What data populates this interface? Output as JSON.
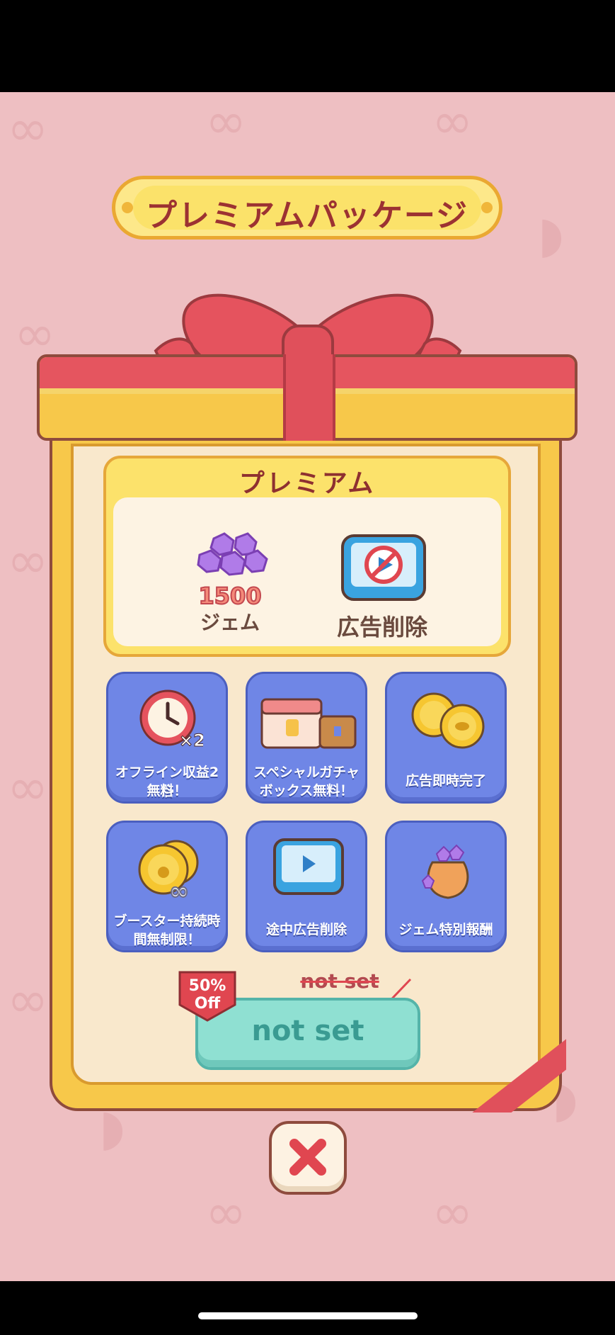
{
  "banner": {
    "title": "プレミアムパッケージ"
  },
  "premium": {
    "title": "プレミアム",
    "gems_count": "1500",
    "gems_label": "ジェム",
    "ad_remove_label": "広告削除"
  },
  "perks": [
    {
      "icon": "clock-x2-icon",
      "line1": "オフライン収益2倍",
      "line2": "無料！"
    },
    {
      "icon": "gacha-box-icon",
      "line1": "スペシャルガチャ",
      "line2": "ボックス無料！"
    },
    {
      "icon": "coins-icon",
      "line1": "広告即時完了",
      "line2": ""
    },
    {
      "icon": "infinite-coins-icon",
      "line1": "ブースター持続時",
      "line2": "間無制限！"
    },
    {
      "icon": "play-monitor-icon",
      "line1": "途中広告削除",
      "line2": ""
    },
    {
      "icon": "gem-bag-icon",
      "line1": "ジェム特別報酬",
      "line2": ""
    }
  ],
  "purchase": {
    "discount_line1": "50%",
    "discount_line2": "Off",
    "old_price": "not set",
    "price": "not set"
  },
  "colors": {
    "background": "#eebfc2",
    "tile": "#6f86e6",
    "buy_button": "#8fe0d2",
    "ribbon": "#e0505b"
  }
}
